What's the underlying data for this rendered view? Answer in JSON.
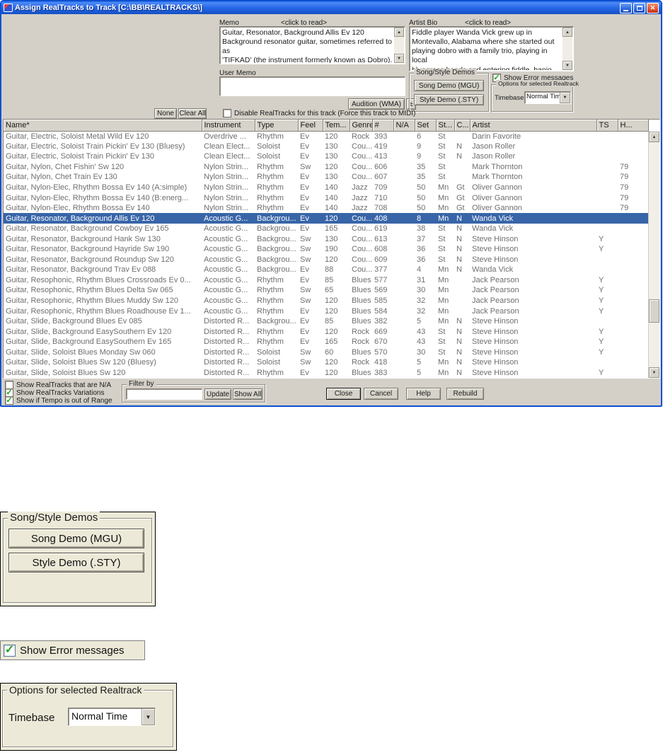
{
  "window": {
    "title": "Assign RealTracks to Track  [C:\\BB\\REALTRACKS\\]"
  },
  "memo": {
    "label": "Memo",
    "hint": "<click to read>",
    "text": "Guitar, Resonator, Background Allis Ev 120\nBackground resonator guitar, sometimes referred to as\n'TIFKAD' (the instrument formerly known as Dobro)."
  },
  "artist_bio": {
    "label": "Artist Bio",
    "hint": "<click to read>",
    "text": "Fiddle player Wanda Vick grew up in\nMontevallo, Alabama where she started out\nplaying dobro with a family trio, playing in local\nbluegrass bands and entering fiddle, banjo,"
  },
  "user_memo": {
    "label": "User Memo",
    "text": ""
  },
  "audition": {
    "button": "Audition (WMA)",
    "toggle": "±"
  },
  "demos": {
    "title": "Song/Style Demos",
    "song_demo": "Song Demo (MGU)",
    "style_demo": "Style Demo (.STY)"
  },
  "show_error": {
    "label": "Show Error messages",
    "checked": true
  },
  "options": {
    "title": "Options for selected Realtrack",
    "timebase_label": "Timebase",
    "timebase_value": "Normal Time"
  },
  "actions": {
    "none": "None",
    "clear_all": "Clear All"
  },
  "disable_midi": {
    "label": "Disable RealTracks for this track (Force this track to MIDI)",
    "checked": false
  },
  "table": {
    "columns": [
      "Name*",
      "Instrument",
      "Type",
      "Feel",
      "Tem...",
      "Genre",
      "#",
      "N/A",
      "Set",
      "St...",
      "C...",
      "Artist",
      "TS",
      "H..."
    ],
    "selected_index": 8,
    "rows": [
      [
        "Guitar, Electric, Soloist Metal Wild Ev 120",
        "Overdrive ...",
        "Rhythm",
        "Ev",
        "120",
        "Rock",
        "393",
        "",
        "6",
        "St",
        "",
        "Darin Favorite",
        "",
        ""
      ],
      [
        "Guitar, Electric, Soloist Train Pickin' Ev 130 (Bluesy)",
        "Clean Elect...",
        "Soloist",
        "Ev",
        "130",
        "Cou...",
        "419",
        "",
        "9",
        "St",
        "N",
        "Jason Roller",
        "",
        ""
      ],
      [
        "Guitar, Electric, Soloist Train Pickin' Ev 130",
        "Clean Elect...",
        "Soloist",
        "Ev",
        "130",
        "Cou...",
        "413",
        "",
        "9",
        "St",
        "N",
        "Jason Roller",
        "",
        ""
      ],
      [
        "Guitar, Nylon, Chet Fishin' Sw 120",
        "Nylon Strin...",
        "Rhythm",
        "Sw",
        "120",
        "Cou...",
        "606",
        "",
        "35",
        "St",
        "",
        "Mark Thornton",
        "",
        "79"
      ],
      [
        "Guitar, Nylon, Chet Train Ev 130",
        "Nylon Strin...",
        "Rhythm",
        "Ev",
        "130",
        "Cou...",
        "607",
        "",
        "35",
        "St",
        "",
        "Mark Thornton",
        "",
        "79"
      ],
      [
        "Guitar, Nylon-Elec, Rhythm Bossa Ev 140 (A:simple)",
        "Nylon Strin...",
        "Rhythm",
        "Ev",
        "140",
        "Jazz",
        "709",
        "",
        "50",
        "Mn",
        "Gt",
        "Oliver Gannon",
        "",
        "79"
      ],
      [
        "Guitar, Nylon-Elec, Rhythm Bossa Ev 140 (B:energ...",
        "Nylon Strin...",
        "Rhythm",
        "Ev",
        "140",
        "Jazz",
        "710",
        "",
        "50",
        "Mn",
        "Gt",
        "Oliver Gannon",
        "",
        "79"
      ],
      [
        "Guitar, Nylon-Elec, Rhythm Bossa Ev 140",
        "Nylon Strin...",
        "Rhythm",
        "Ev",
        "140",
        "Jazz",
        "708",
        "",
        "50",
        "Mn",
        "Gt",
        "Oliver Gannon",
        "",
        "79"
      ],
      [
        "Guitar, Resonator, Background Allis Ev 120",
        "Acoustic G...",
        "Backgrou...",
        "Ev",
        "120",
        "Cou...",
        "408",
        "",
        "8",
        "Mn",
        "N",
        "Wanda Vick",
        "",
        ""
      ],
      [
        "Guitar, Resonator, Background Cowboy Ev 165",
        "Acoustic G...",
        "Backgrou...",
        "Ev",
        "165",
        "Cou...",
        "619",
        "",
        "38",
        "St",
        "N",
        "Wanda Vick",
        "",
        ""
      ],
      [
        "Guitar, Resonator, Background Hank Sw 130",
        "Acoustic G...",
        "Backgrou...",
        "Sw",
        "130",
        "Cou...",
        "613",
        "",
        "37",
        "St",
        "N",
        "Steve Hinson",
        "Y",
        ""
      ],
      [
        "Guitar, Resonator, Background Hayride Sw 190",
        "Acoustic G...",
        "Backgrou...",
        "Sw",
        "190",
        "Cou...",
        "608",
        "",
        "36",
        "St",
        "N",
        "Steve Hinson",
        "Y",
        ""
      ],
      [
        "Guitar, Resonator, Background Roundup Sw 120",
        "Acoustic G...",
        "Backgrou...",
        "Sw",
        "120",
        "Cou...",
        "609",
        "",
        "36",
        "St",
        "N",
        "Steve Hinson",
        "",
        ""
      ],
      [
        "Guitar, Resonator, Background Trav Ev 088",
        "Acoustic G...",
        "Backgrou...",
        "Ev",
        "88",
        "Cou...",
        "377",
        "",
        "4",
        "Mn",
        "N",
        "Wanda Vick",
        "",
        ""
      ],
      [
        "Guitar, Resophonic, Rhythm Blues Crossroads Ev 0...",
        "Acoustic G...",
        "Rhythm",
        "Ev",
        "85",
        "Blues",
        "577",
        "",
        "31",
        "Mn",
        "",
        "Jack Pearson",
        "Y",
        ""
      ],
      [
        "Guitar, Resophonic, Rhythm Blues Delta Sw 065",
        "Acoustic G...",
        "Rhythm",
        "Sw",
        "65",
        "Blues",
        "569",
        "",
        "30",
        "Mn",
        "",
        "Jack Pearson",
        "Y",
        ""
      ],
      [
        "Guitar, Resophonic, Rhythm Blues Muddy Sw 120",
        "Acoustic G...",
        "Rhythm",
        "Sw",
        "120",
        "Blues",
        "585",
        "",
        "32",
        "Mn",
        "",
        "Jack Pearson",
        "Y",
        ""
      ],
      [
        "Guitar, Resophonic, Rhythm Blues Roadhouse Ev 1...",
        "Acoustic G...",
        "Rhythm",
        "Ev",
        "120",
        "Blues",
        "584",
        "",
        "32",
        "Mn",
        "",
        "Jack Pearson",
        "Y",
        ""
      ],
      [
        "Guitar, Slide, Background Blues Ev 085",
        "Distorted R...",
        "Backgrou...",
        "Ev",
        "85",
        "Blues",
        "382",
        "",
        "5",
        "Mn",
        "N",
        "Steve Hinson",
        "",
        ""
      ],
      [
        "Guitar, Slide, Background EasySouthern Ev 120",
        "Distorted R...",
        "Rhythm",
        "Ev",
        "120",
        "Rock",
        "669",
        "",
        "43",
        "St",
        "N",
        "Steve Hinson",
        "Y",
        ""
      ],
      [
        "Guitar, Slide, Background EasySouthern Ev 165",
        "Distorted R...",
        "Rhythm",
        "Ev",
        "165",
        "Rock",
        "670",
        "",
        "43",
        "St",
        "N",
        "Steve Hinson",
        "Y",
        ""
      ],
      [
        "Guitar, Slide, Soloist Blues Monday Sw 060",
        "Distorted R...",
        "Soloist",
        "Sw",
        "60",
        "Blues",
        "570",
        "",
        "30",
        "St",
        "N",
        "Steve Hinson",
        "Y",
        ""
      ],
      [
        "Guitar, Slide, Soloist Blues Sw 120 (Bluesy)",
        "Distorted R...",
        "Soloist",
        "Sw",
        "120",
        "Rock",
        "418",
        "",
        "5",
        "Mn",
        "N",
        "Steve Hinson",
        "",
        ""
      ],
      [
        "Guitar, Slide, Soloist Blues Sw 120",
        "Distorted R...",
        "Rhythm",
        "Ev",
        "120",
        "Blues",
        "383",
        "",
        "5",
        "Mn",
        "N",
        "Steve Hinson",
        "Y",
        ""
      ]
    ]
  },
  "footer": {
    "show_na": {
      "label": "Show RealTracks that are N/A",
      "checked": false
    },
    "show_variations": {
      "label": "Show RealTracks Variations",
      "checked": true
    },
    "show_tempo": {
      "label": "Show if Tempo is out of Range",
      "checked": true
    },
    "filter": {
      "title": "Filter by",
      "value": "",
      "update": "Update",
      "show_all": "Show All"
    },
    "close": "Close",
    "cancel": "Cancel",
    "help": "Help",
    "rebuild": "Rebuild"
  }
}
